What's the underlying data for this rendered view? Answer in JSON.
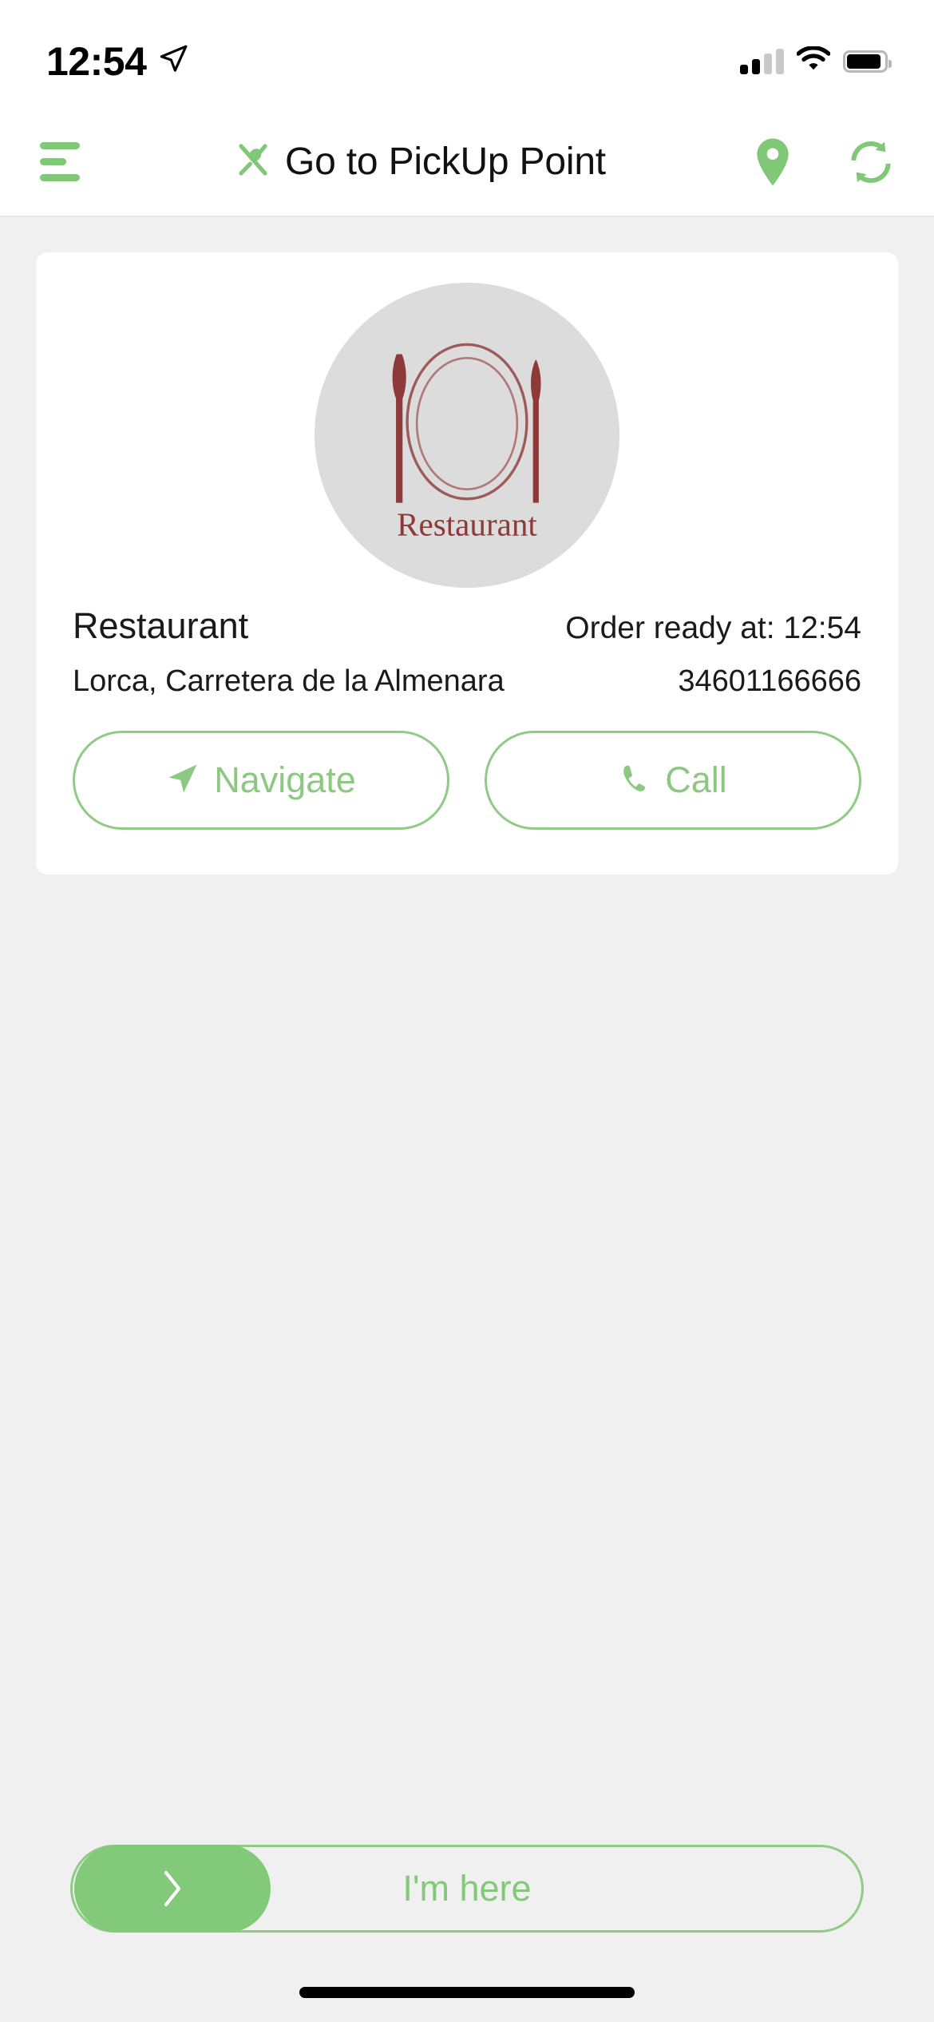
{
  "status_bar": {
    "time": "12:54",
    "location_arrow_icon": "location-arrow-icon",
    "signal_icon": "cellular-signal-icon",
    "wifi_icon": "wifi-icon",
    "battery_icon": "battery-icon"
  },
  "header": {
    "menu_icon": "hamburger-menu-icon",
    "title_icon": "fork-spoon-icon",
    "title": "Go to PickUp Point",
    "map_pin_icon": "map-pin-icon",
    "refresh_icon": "refresh-sync-icon"
  },
  "card": {
    "logo": {
      "icon": "restaurant-logo-icon",
      "caption": "Restaurant"
    },
    "place_name": "Restaurant",
    "order_ready": "Order ready at: 12:54",
    "address": "Lorca, Carretera de la Almenara",
    "phone": "34601166666",
    "buttons": [
      {
        "label": "Navigate",
        "icon": "navigate-arrow-icon"
      },
      {
        "label": "Call",
        "icon": "phone-icon"
      }
    ]
  },
  "slider": {
    "label": "I'm here",
    "thumb_icon": "chevron-right-icon"
  },
  "colors": {
    "accent_green": "#82c97a",
    "accent_green_border": "#8fcb84",
    "page_background": "#f0f0f0",
    "card_background": "#ffffff",
    "logo_background": "#dcdcdc",
    "logo_mark": "#8d3a3a",
    "text_primary": "#1a1a1a"
  }
}
